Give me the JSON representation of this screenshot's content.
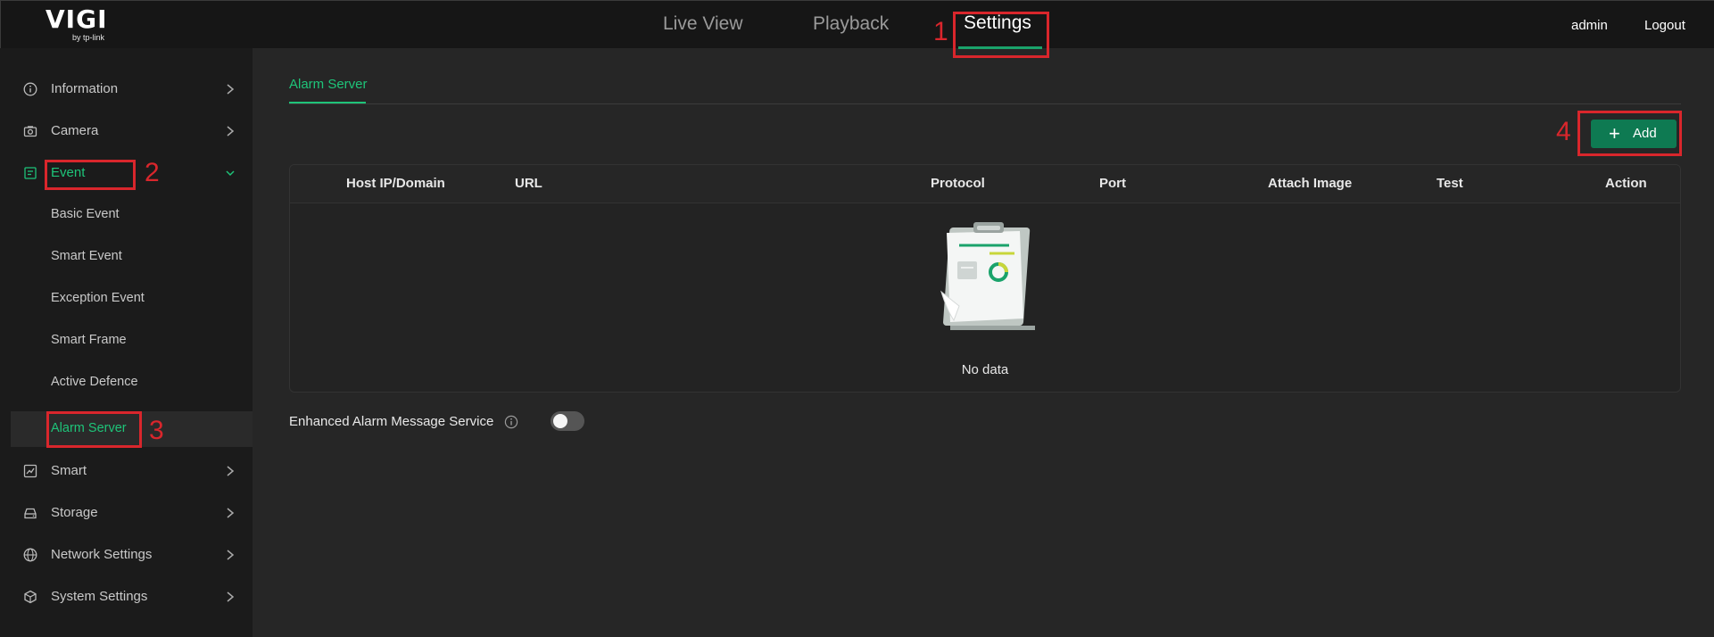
{
  "logo": {
    "brand": "VIGI",
    "by": "by tp-link"
  },
  "nav": {
    "tabs": [
      {
        "label": "Live View"
      },
      {
        "label": "Playback"
      },
      {
        "label": "Settings"
      }
    ],
    "user": "admin",
    "logout": "Logout"
  },
  "sidebar": {
    "items": [
      {
        "label": "Information",
        "icon": "info-circle-icon"
      },
      {
        "label": "Camera",
        "icon": "camera-icon"
      },
      {
        "label": "Event",
        "icon": "event-doc-icon"
      },
      {
        "label": "Smart",
        "icon": "chart-icon"
      },
      {
        "label": "Storage",
        "icon": "storage-icon"
      },
      {
        "label": "Network Settings",
        "icon": "globe-icon"
      },
      {
        "label": "System Settings",
        "icon": "cube-icon"
      }
    ],
    "event_sub": [
      {
        "label": "Basic Event"
      },
      {
        "label": "Smart Event"
      },
      {
        "label": "Exception Event"
      },
      {
        "label": "Smart Frame"
      },
      {
        "label": "Active Defence"
      },
      {
        "label": "Alarm Server"
      }
    ]
  },
  "content": {
    "tab": "Alarm Server",
    "add_label": "Add",
    "columns": [
      "Host IP/Domain",
      "URL",
      "Protocol",
      "Port",
      "Attach Image",
      "Test",
      "Action"
    ],
    "empty_text": "No data",
    "enhanced_label": "Enhanced Alarm Message Service",
    "enhanced_enabled": false
  },
  "annotations": [
    "1",
    "2",
    "3",
    "4"
  ],
  "colors": {
    "accent": "#1ec479",
    "button": "#0e7a52",
    "annotation": "#d9262c"
  }
}
